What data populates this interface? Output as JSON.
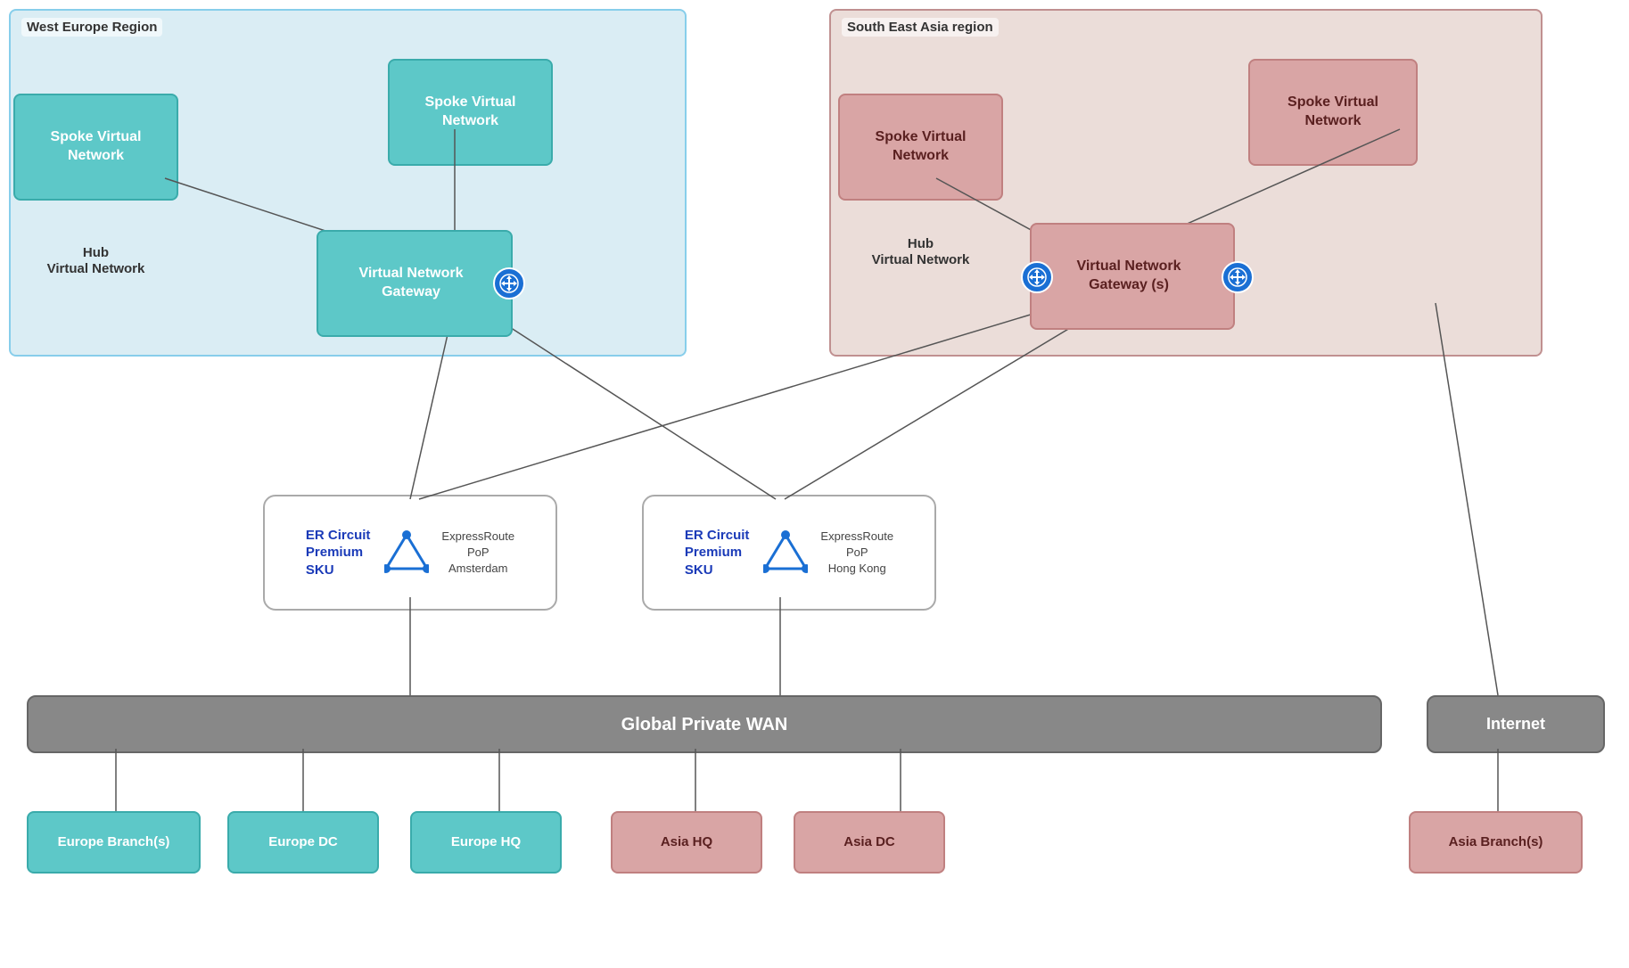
{
  "regions": {
    "west": {
      "label": "West Europe Region"
    },
    "sea": {
      "label": "South East Asia region"
    }
  },
  "west_nodes": {
    "spoke1": "Spoke Virtual\nNetwork",
    "spoke2": "Spoke Virtual\nNetwork",
    "hub": "Hub\nVirtual Network",
    "gateway": "Virtual Network\nGateway"
  },
  "sea_nodes": {
    "spoke1": "Spoke Virtual\nNetwork",
    "spoke2": "Spoke Virtual\nNetwork",
    "hub": "Hub\nVirtual Network",
    "gateway": "Virtual Network\nGateway (s)"
  },
  "er_boxes": {
    "amsterdam": {
      "circuit_label": "ER Circuit\nPremium\nSKU",
      "pop_label": "ExpressRoute\nPoP\nAmsterdam"
    },
    "hongkong": {
      "circuit_label": "ER Circuit\nPremium\nSKU",
      "pop_label": "ExpressRoute\nPoP\nHong Kong"
    }
  },
  "wan": {
    "label": "Global Private WAN"
  },
  "internet": {
    "label": "Internet"
  },
  "bottom_nodes": {
    "europe_branch": "Europe Branch(s)",
    "europe_dc": "Europe DC",
    "europe_hq": "Europe HQ",
    "asia_hq": "Asia HQ",
    "asia_dc": "Asia DC",
    "asia_branch": "Asia Branch(s)"
  }
}
